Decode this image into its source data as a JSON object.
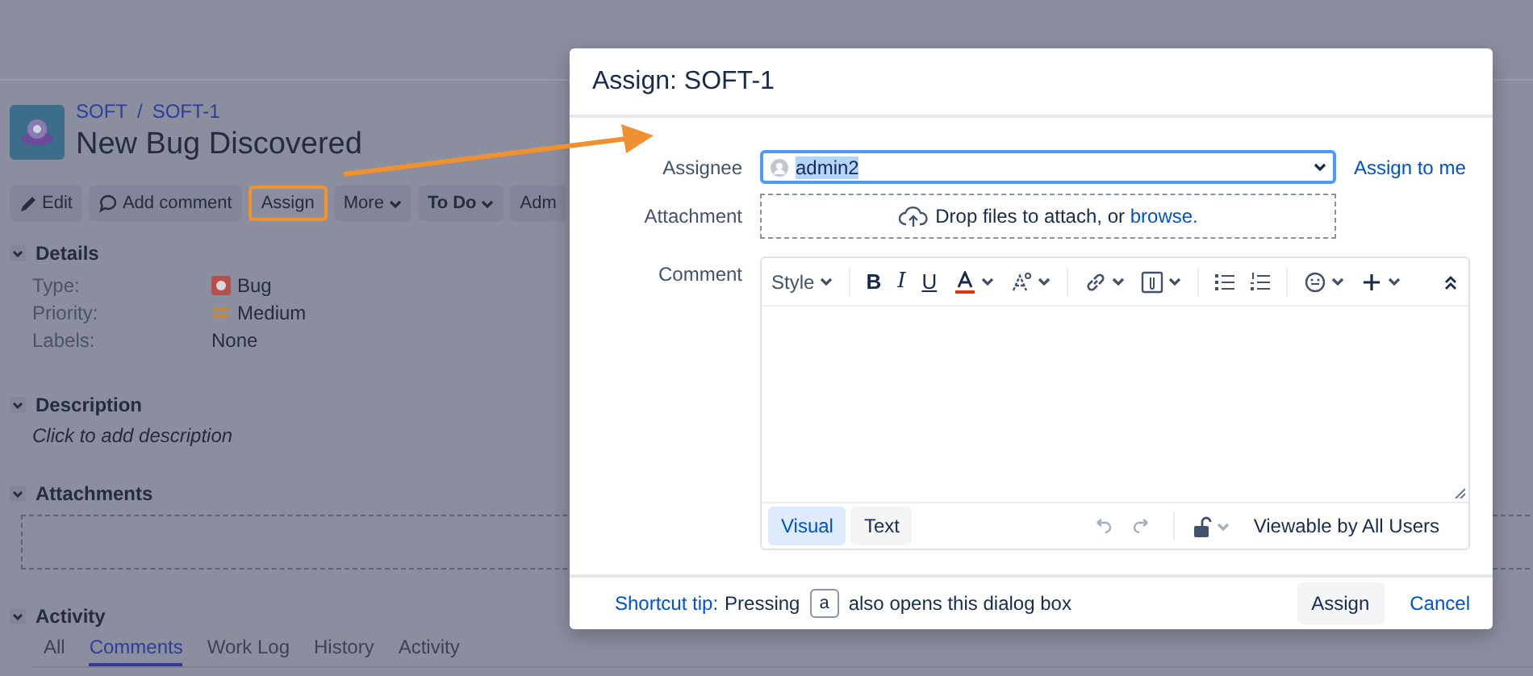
{
  "issue": {
    "breadcrumb": [
      {
        "label": "SOFT"
      },
      {
        "label": "SOFT-1"
      }
    ],
    "separator": "/",
    "title": "New Bug Discovered"
  },
  "toolbar": [
    {
      "kind": "edit",
      "label": "Edit"
    },
    {
      "kind": "comment",
      "label": "Add comment"
    },
    {
      "kind": "highlighted",
      "label": "Assign"
    },
    {
      "kind": "menu",
      "label": "More"
    },
    {
      "kind": "status",
      "label": "To Do"
    },
    {
      "kind": "plain",
      "label": "Adm"
    }
  ],
  "details": {
    "heading": "Details",
    "fields": [
      {
        "kind": "bug",
        "label": "Type:",
        "value": "Bug"
      },
      {
        "kind": "priority",
        "label": "Priority:",
        "value": "Medium"
      },
      {
        "kind": "plain",
        "label": "Labels:",
        "value": "None"
      }
    ]
  },
  "description": {
    "heading": "Description",
    "placeholder": "Click to add description"
  },
  "attachments": {
    "heading": "Attachments"
  },
  "activity": {
    "heading": "Activity",
    "tabs": [
      {
        "label": "All",
        "selected": false
      },
      {
        "label": "Comments",
        "selected": true
      },
      {
        "label": "Work Log",
        "selected": false
      },
      {
        "label": "History",
        "selected": false
      },
      {
        "label": "Activity",
        "selected": false
      }
    ]
  },
  "dialog": {
    "title": "Assign: SOFT-1",
    "assignee_label": "Assignee",
    "assignee_value": "admin2",
    "assign_to_me": "Assign to me",
    "attachment_label": "Attachment",
    "drop_text": "Drop files to attach, or",
    "browse_link": "browse.",
    "comment_label": "Comment",
    "style_menu": "Style",
    "format_buttons": [
      "B",
      "I",
      "U"
    ],
    "modes": [
      {
        "label": "Visual",
        "selected": true
      },
      {
        "label": "Text",
        "selected": false
      }
    ],
    "visibility": "Viewable by All Users",
    "shortcut_tip": {
      "label": "Shortcut tip:",
      "before": "Pressing",
      "key": "a",
      "after": "also opens this dialog box"
    },
    "submit": "Assign",
    "cancel": "Cancel"
  }
}
